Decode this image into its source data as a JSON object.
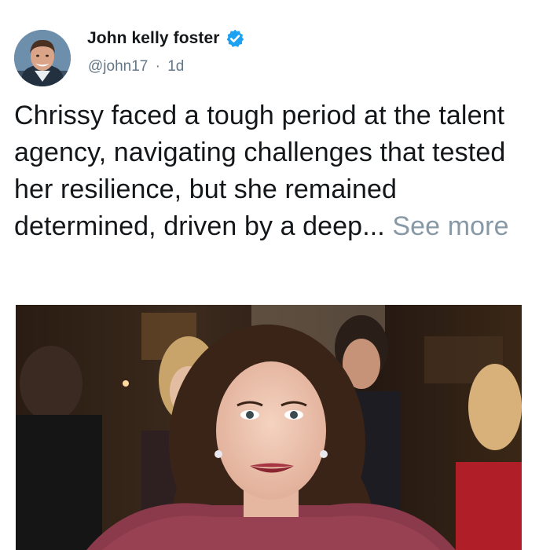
{
  "user": {
    "display_name": "John kelly foster",
    "handle": "@john17",
    "separator": "·",
    "time_ago": "1d",
    "verified": true,
    "verified_color": "#1da1f2"
  },
  "tweet": {
    "text": "Chrissy faced a tough period at the talent agency, navigating challenges that tested her resilience, but she remained determined, driven by a deep...",
    "see_more_label": "See more",
    "text_color": "#14171a",
    "see_more_color": "#8899a6"
  },
  "media": {
    "image_icon": "photo-image",
    "description_icon": "woman-smiling-at-event"
  },
  "icons": {
    "verified": "verified-badge-icon",
    "avatar": "profile-photo"
  }
}
